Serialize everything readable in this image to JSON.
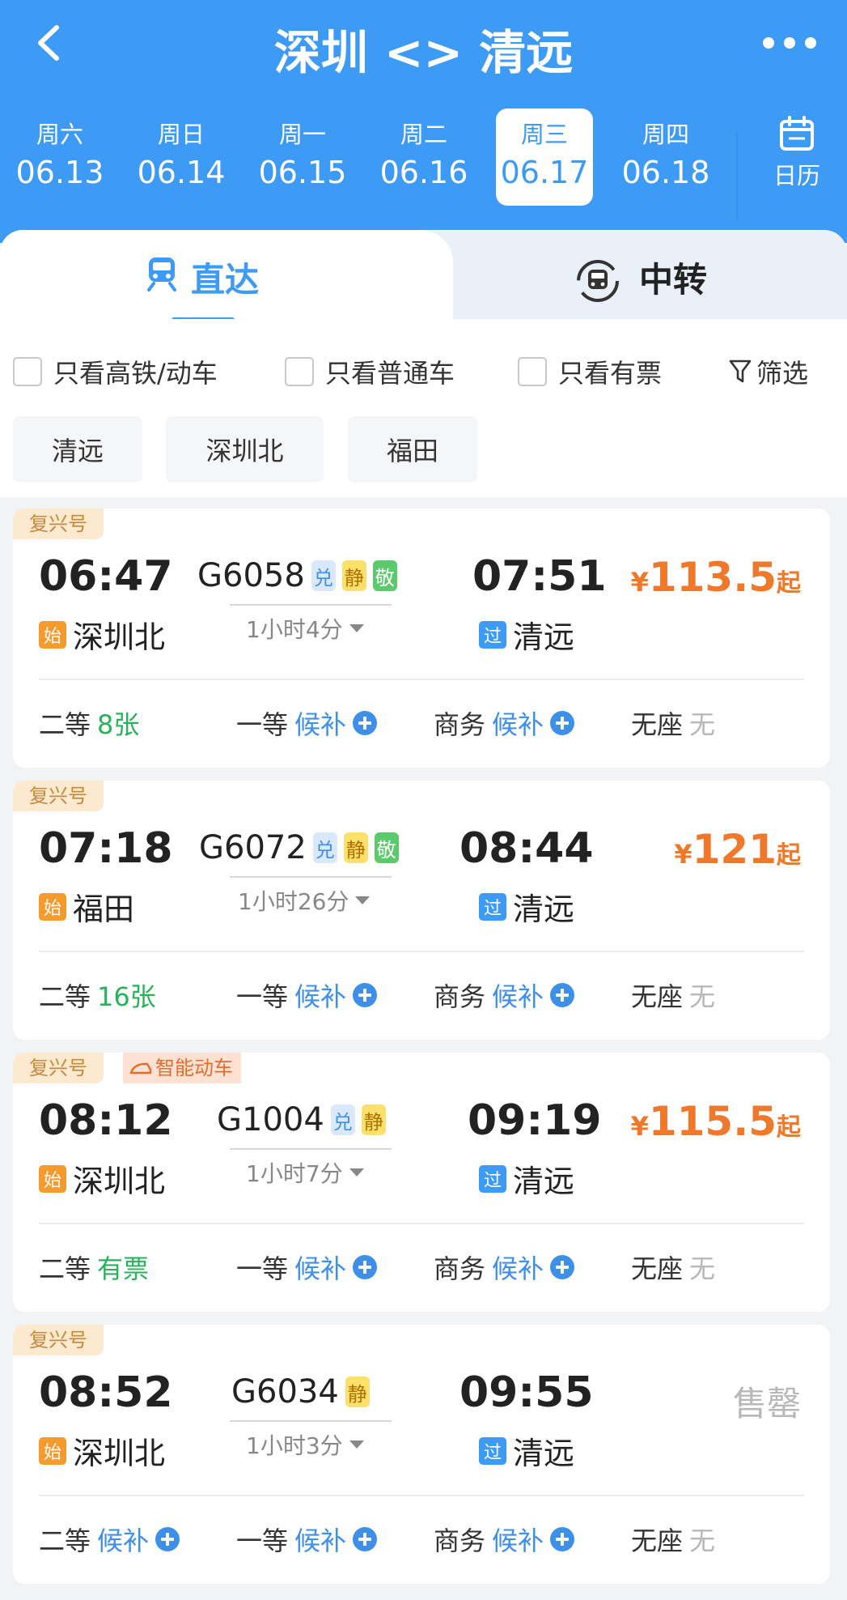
{
  "header": {
    "title": "深圳 <> 清远",
    "back_icon": "chevron-left-icon",
    "more_icon": "more-dots-icon"
  },
  "dates": [
    {
      "dow": "周六",
      "md": "06.13",
      "active": false
    },
    {
      "dow": "周日",
      "md": "06.14",
      "active": false
    },
    {
      "dow": "周一",
      "md": "06.15",
      "active": false
    },
    {
      "dow": "周二",
      "md": "06.16",
      "active": false
    },
    {
      "dow": "周三",
      "md": "06.17",
      "active": true
    },
    {
      "dow": "周四",
      "md": "06.18",
      "active": false
    }
  ],
  "calendar": {
    "label": "日历",
    "icon": "calendar-icon"
  },
  "tabs": {
    "direct": {
      "label": "直达",
      "icon": "train-icon"
    },
    "transfer": {
      "label": "中转",
      "icon": "transfer-icon"
    }
  },
  "filters": {
    "high_speed": "只看高铁/动车",
    "normal": "只看普通车",
    "available": "只看有票",
    "filter_label": "筛选",
    "filter_icon": "funnel-icon"
  },
  "stations": [
    "清远",
    "深圳北",
    "福田"
  ],
  "trains": [
    {
      "tag": "复兴号",
      "dep_time": "06:47",
      "dep_badge": "始",
      "dep_station": "深圳北",
      "number": "G6058",
      "badges": [
        "兑",
        "静",
        "敬"
      ],
      "duration": "1小时4分",
      "arr_time": "07:51",
      "arr_badge": "过",
      "arr_station": "清远",
      "price_symbol": "¥",
      "price": "113.5",
      "price_suffix": "起",
      "seats": [
        {
          "cls": "二等",
          "status": "8张"
        },
        {
          "cls": "一等",
          "status": "候补"
        },
        {
          "cls": "商务",
          "status": "候补"
        },
        {
          "cls": "无座",
          "status": "无"
        }
      ]
    },
    {
      "tag": "复兴号",
      "dep_time": "07:18",
      "dep_badge": "始",
      "dep_station": "福田",
      "number": "G6072",
      "badges": [
        "兑",
        "静",
        "敬"
      ],
      "duration": "1小时26分",
      "arr_time": "08:44",
      "arr_badge": "过",
      "arr_station": "清远",
      "price_symbol": "¥",
      "price": "121",
      "price_suffix": "起",
      "seats": [
        {
          "cls": "二等",
          "status": "16张"
        },
        {
          "cls": "一等",
          "status": "候补"
        },
        {
          "cls": "商务",
          "status": "候补"
        },
        {
          "cls": "无座",
          "status": "无"
        }
      ]
    },
    {
      "tag": "复兴号",
      "tag2": "智能动车",
      "dep_time": "08:12",
      "dep_badge": "始",
      "dep_station": "深圳北",
      "number": "G1004",
      "badges": [
        "兑",
        "静"
      ],
      "duration": "1小时7分",
      "arr_time": "09:19",
      "arr_badge": "过",
      "arr_station": "清远",
      "price_symbol": "¥",
      "price": "115.5",
      "price_suffix": "起",
      "seats": [
        {
          "cls": "二等",
          "status": "有票"
        },
        {
          "cls": "一等",
          "status": "候补"
        },
        {
          "cls": "商务",
          "status": "候补"
        },
        {
          "cls": "无座",
          "status": "无"
        }
      ]
    },
    {
      "tag": "复兴号",
      "dep_time": "08:52",
      "dep_badge": "始",
      "dep_station": "深圳北",
      "number": "G6034",
      "badges": [
        "静"
      ],
      "duration": "1小时3分",
      "arr_time": "09:55",
      "arr_badge": "过",
      "arr_station": "清远",
      "sold_out": "售罄",
      "seats": [
        {
          "cls": "二等",
          "status": "候补"
        },
        {
          "cls": "一等",
          "status": "候补"
        },
        {
          "cls": "商务",
          "status": "候补"
        },
        {
          "cls": "无座",
          "status": "无"
        }
      ]
    }
  ],
  "colors": {
    "brand": "#3e9bf5",
    "price": "#f0782a",
    "available": "#2bb05c",
    "waitlist": "#3e8fe8",
    "muted": "#b8b8b8"
  }
}
